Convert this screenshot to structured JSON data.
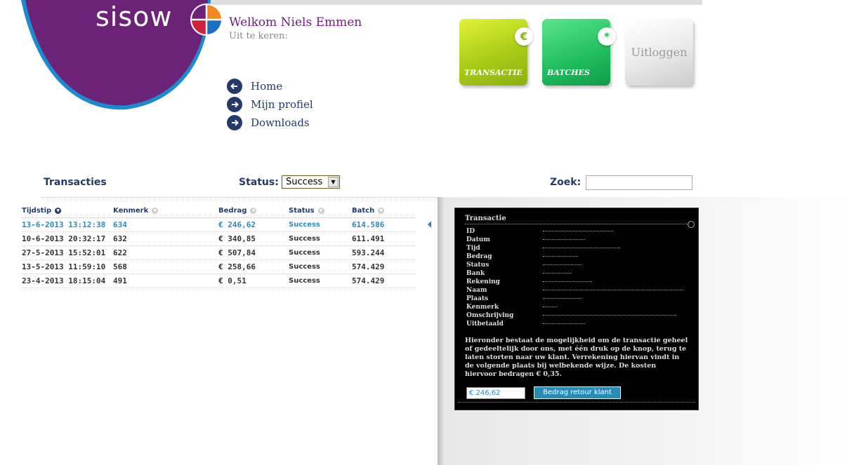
{
  "header": {
    "logo": "sisow",
    "welcome": "Welkom Niels Emmen",
    "subtitle": "Uit te keren:"
  },
  "nav": {
    "items": [
      {
        "label": "Home",
        "icon": "arrow-left-icon"
      },
      {
        "label": "Mijn profiel",
        "icon": "arrow-right-icon"
      },
      {
        "label": "Downloads",
        "icon": "arrow-right-icon"
      }
    ]
  },
  "tiles": {
    "transactie": {
      "label": "TRANSACTIE",
      "badge": "€"
    },
    "batches": {
      "label": "BATCHES",
      "badge": "*"
    },
    "logout": {
      "label": "Uitloggen"
    }
  },
  "filters": {
    "section_title": "Transacties",
    "status_label": "Status:",
    "status_value": "Success",
    "search_label": "Zoek:",
    "search_value": ""
  },
  "table": {
    "columns": [
      "Tijdstip",
      "Kenmerk",
      "Bedrag",
      "Status",
      "Batch"
    ],
    "rows": [
      {
        "tijdstip": "13-6-2013 13:12:38",
        "kenmerk": "634",
        "bedrag": "€ 246,62",
        "status": "Success",
        "batch": "614.586"
      },
      {
        "tijdstip": "10-6-2013 20:32:17",
        "kenmerk": "632",
        "bedrag": "€ 340,85",
        "status": "Success",
        "batch": "611.491"
      },
      {
        "tijdstip": "27-5-2013 15:52:01",
        "kenmerk": "622",
        "bedrag": "€ 507,84",
        "status": "Success",
        "batch": "593.244"
      },
      {
        "tijdstip": "13-5-2013 11:59:10",
        "kenmerk": "568",
        "bedrag": "€ 258,66",
        "status": "Success",
        "batch": "574.429"
      },
      {
        "tijdstip": "23-4-2013 18:15:04",
        "kenmerk": "491",
        "bedrag": "€ 0,51",
        "status": "Success",
        "batch": "574.429"
      }
    ]
  },
  "detail": {
    "title": "Transactie",
    "fields": [
      "ID",
      "Datum",
      "Tijd",
      "Bedrag",
      "Status",
      "Bank",
      "Rekening",
      "Naam",
      "Plaats",
      "Kenmerk",
      "Omschrijving",
      "Uitbetaald"
    ],
    "text": "Hieronder bestaat de mogelijkheid om de transactie geheel of gedeeltelijk door ons, met één druk op de knop, terug te laten storten naar uw klant. Verrekening hiervan vindt in de volgende plaats bij welbekende wijze. De kosten hiervoor bedragen € 0,35.",
    "amount": "€ 246,62",
    "refund_button": "Bedrag retour klant"
  },
  "colors": {
    "brand_purple": "#6b2277",
    "navy": "#233a6b",
    "accent_blue": "#2a8ab8"
  }
}
